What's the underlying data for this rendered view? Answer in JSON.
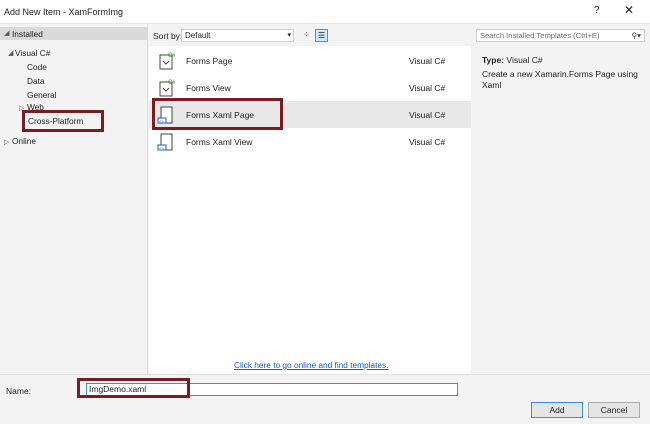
{
  "window": {
    "title": "Add New Item - XamFormImg",
    "help": "?",
    "close": "✕"
  },
  "tree": {
    "installed": "Installed",
    "visual_csharp": "Visual C#",
    "code": "Code",
    "data": "Data",
    "general": "General",
    "web": "Web",
    "cross_platform": "Cross-Platform",
    "online": "Online"
  },
  "toolbar": {
    "sort_label": "Sort by:",
    "sort_value": "Default"
  },
  "templates": [
    {
      "name": "Forms Page",
      "lang": "Visual C#"
    },
    {
      "name": "Forms View",
      "lang": "Visual C#"
    },
    {
      "name": "Forms Xaml Page",
      "lang": "Visual C#"
    },
    {
      "name": "Forms Xaml View",
      "lang": "Visual C#"
    }
  ],
  "online_link": "Click here to go online and find templates.",
  "search": {
    "placeholder": "Search Installed Templates (Ctrl+E)"
  },
  "details": {
    "type_label": "Type:",
    "type_value": "Visual C#",
    "description": "Create a new Xamarin.Forms Page using Xaml"
  },
  "name_field": {
    "label": "Name:",
    "value": "ImgDemo.xaml"
  },
  "buttons": {
    "add": "Add",
    "cancel": "Cancel"
  },
  "colors": {
    "highlight_box": "#7a1c22",
    "link": "#0e5bd9",
    "focus": "#3c8ce6"
  }
}
